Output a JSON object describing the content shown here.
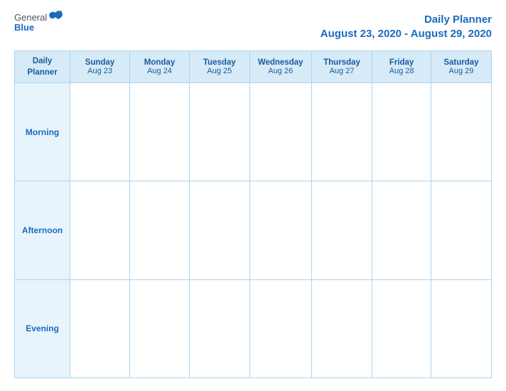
{
  "header": {
    "logo_general": "General",
    "logo_blue": "Blue",
    "title": "Daily Planner",
    "date_range": "August 23, 2020 - August 29, 2020"
  },
  "table": {
    "corner_label_line1": "Daily",
    "corner_label_line2": "Planner",
    "columns": [
      {
        "day": "Sunday",
        "date": "Aug 23"
      },
      {
        "day": "Monday",
        "date": "Aug 24"
      },
      {
        "day": "Tuesday",
        "date": "Aug 25"
      },
      {
        "day": "Wednesday",
        "date": "Aug 26"
      },
      {
        "day": "Thursday",
        "date": "Aug 27"
      },
      {
        "day": "Friday",
        "date": "Aug 28"
      },
      {
        "day": "Saturday",
        "date": "Aug 29"
      }
    ],
    "rows": [
      {
        "label": "Morning"
      },
      {
        "label": "Afternoon"
      },
      {
        "label": "Evening"
      }
    ]
  }
}
